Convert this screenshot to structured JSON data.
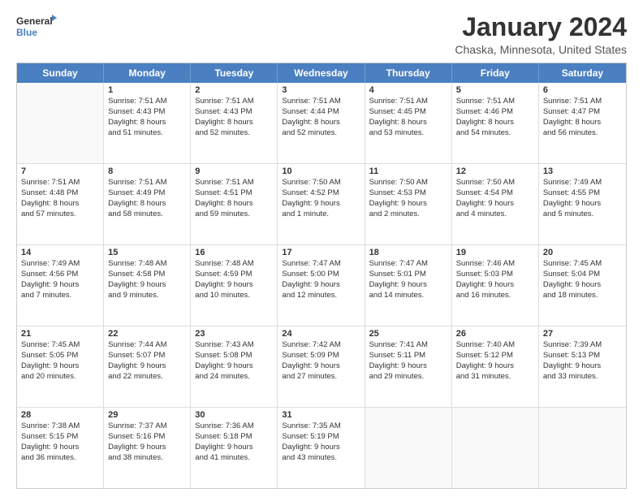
{
  "logo": {
    "line1": "General",
    "line2": "Blue"
  },
  "title": "January 2024",
  "subtitle": "Chaska, Minnesota, United States",
  "header_days": [
    "Sunday",
    "Monday",
    "Tuesday",
    "Wednesday",
    "Thursday",
    "Friday",
    "Saturday"
  ],
  "weeks": [
    [
      {
        "day": "",
        "lines": []
      },
      {
        "day": "1",
        "lines": [
          "Sunrise: 7:51 AM",
          "Sunset: 4:43 PM",
          "Daylight: 8 hours",
          "and 51 minutes."
        ]
      },
      {
        "day": "2",
        "lines": [
          "Sunrise: 7:51 AM",
          "Sunset: 4:43 PM",
          "Daylight: 8 hours",
          "and 52 minutes."
        ]
      },
      {
        "day": "3",
        "lines": [
          "Sunrise: 7:51 AM",
          "Sunset: 4:44 PM",
          "Daylight: 8 hours",
          "and 52 minutes."
        ]
      },
      {
        "day": "4",
        "lines": [
          "Sunrise: 7:51 AM",
          "Sunset: 4:45 PM",
          "Daylight: 8 hours",
          "and 53 minutes."
        ]
      },
      {
        "day": "5",
        "lines": [
          "Sunrise: 7:51 AM",
          "Sunset: 4:46 PM",
          "Daylight: 8 hours",
          "and 54 minutes."
        ]
      },
      {
        "day": "6",
        "lines": [
          "Sunrise: 7:51 AM",
          "Sunset: 4:47 PM",
          "Daylight: 8 hours",
          "and 56 minutes."
        ]
      }
    ],
    [
      {
        "day": "7",
        "lines": [
          "Sunrise: 7:51 AM",
          "Sunset: 4:48 PM",
          "Daylight: 8 hours",
          "and 57 minutes."
        ]
      },
      {
        "day": "8",
        "lines": [
          "Sunrise: 7:51 AM",
          "Sunset: 4:49 PM",
          "Daylight: 8 hours",
          "and 58 minutes."
        ]
      },
      {
        "day": "9",
        "lines": [
          "Sunrise: 7:51 AM",
          "Sunset: 4:51 PM",
          "Daylight: 8 hours",
          "and 59 minutes."
        ]
      },
      {
        "day": "10",
        "lines": [
          "Sunrise: 7:50 AM",
          "Sunset: 4:52 PM",
          "Daylight: 9 hours",
          "and 1 minute."
        ]
      },
      {
        "day": "11",
        "lines": [
          "Sunrise: 7:50 AM",
          "Sunset: 4:53 PM",
          "Daylight: 9 hours",
          "and 2 minutes."
        ]
      },
      {
        "day": "12",
        "lines": [
          "Sunrise: 7:50 AM",
          "Sunset: 4:54 PM",
          "Daylight: 9 hours",
          "and 4 minutes."
        ]
      },
      {
        "day": "13",
        "lines": [
          "Sunrise: 7:49 AM",
          "Sunset: 4:55 PM",
          "Daylight: 9 hours",
          "and 5 minutes."
        ]
      }
    ],
    [
      {
        "day": "14",
        "lines": [
          "Sunrise: 7:49 AM",
          "Sunset: 4:56 PM",
          "Daylight: 9 hours",
          "and 7 minutes."
        ]
      },
      {
        "day": "15",
        "lines": [
          "Sunrise: 7:48 AM",
          "Sunset: 4:58 PM",
          "Daylight: 9 hours",
          "and 9 minutes."
        ]
      },
      {
        "day": "16",
        "lines": [
          "Sunrise: 7:48 AM",
          "Sunset: 4:59 PM",
          "Daylight: 9 hours",
          "and 10 minutes."
        ]
      },
      {
        "day": "17",
        "lines": [
          "Sunrise: 7:47 AM",
          "Sunset: 5:00 PM",
          "Daylight: 9 hours",
          "and 12 minutes."
        ]
      },
      {
        "day": "18",
        "lines": [
          "Sunrise: 7:47 AM",
          "Sunset: 5:01 PM",
          "Daylight: 9 hours",
          "and 14 minutes."
        ]
      },
      {
        "day": "19",
        "lines": [
          "Sunrise: 7:46 AM",
          "Sunset: 5:03 PM",
          "Daylight: 9 hours",
          "and 16 minutes."
        ]
      },
      {
        "day": "20",
        "lines": [
          "Sunrise: 7:45 AM",
          "Sunset: 5:04 PM",
          "Daylight: 9 hours",
          "and 18 minutes."
        ]
      }
    ],
    [
      {
        "day": "21",
        "lines": [
          "Sunrise: 7:45 AM",
          "Sunset: 5:05 PM",
          "Daylight: 9 hours",
          "and 20 minutes."
        ]
      },
      {
        "day": "22",
        "lines": [
          "Sunrise: 7:44 AM",
          "Sunset: 5:07 PM",
          "Daylight: 9 hours",
          "and 22 minutes."
        ]
      },
      {
        "day": "23",
        "lines": [
          "Sunrise: 7:43 AM",
          "Sunset: 5:08 PM",
          "Daylight: 9 hours",
          "and 24 minutes."
        ]
      },
      {
        "day": "24",
        "lines": [
          "Sunrise: 7:42 AM",
          "Sunset: 5:09 PM",
          "Daylight: 9 hours",
          "and 27 minutes."
        ]
      },
      {
        "day": "25",
        "lines": [
          "Sunrise: 7:41 AM",
          "Sunset: 5:11 PM",
          "Daylight: 9 hours",
          "and 29 minutes."
        ]
      },
      {
        "day": "26",
        "lines": [
          "Sunrise: 7:40 AM",
          "Sunset: 5:12 PM",
          "Daylight: 9 hours",
          "and 31 minutes."
        ]
      },
      {
        "day": "27",
        "lines": [
          "Sunrise: 7:39 AM",
          "Sunset: 5:13 PM",
          "Daylight: 9 hours",
          "and 33 minutes."
        ]
      }
    ],
    [
      {
        "day": "28",
        "lines": [
          "Sunrise: 7:38 AM",
          "Sunset: 5:15 PM",
          "Daylight: 9 hours",
          "and 36 minutes."
        ]
      },
      {
        "day": "29",
        "lines": [
          "Sunrise: 7:37 AM",
          "Sunset: 5:16 PM",
          "Daylight: 9 hours",
          "and 38 minutes."
        ]
      },
      {
        "day": "30",
        "lines": [
          "Sunrise: 7:36 AM",
          "Sunset: 5:18 PM",
          "Daylight: 9 hours",
          "and 41 minutes."
        ]
      },
      {
        "day": "31",
        "lines": [
          "Sunrise: 7:35 AM",
          "Sunset: 5:19 PM",
          "Daylight: 9 hours",
          "and 43 minutes."
        ]
      },
      {
        "day": "",
        "lines": []
      },
      {
        "day": "",
        "lines": []
      },
      {
        "day": "",
        "lines": []
      }
    ]
  ]
}
